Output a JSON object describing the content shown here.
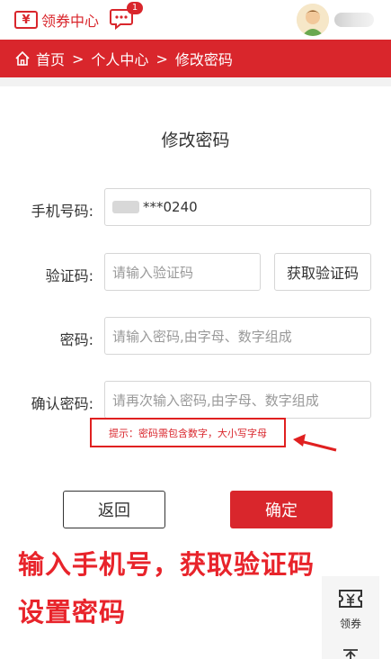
{
  "header": {
    "logo_mark": "¥",
    "app_name": "领券中心",
    "message_badge": "1"
  },
  "breadcrumb": {
    "items": [
      "首页",
      "个人中心",
      "修改密码"
    ],
    "separator": ">"
  },
  "form": {
    "title": "修改密码",
    "phone": {
      "label": "手机号码:",
      "value": "***0240"
    },
    "code": {
      "label": "验证码:",
      "placeholder": "请输入验证码",
      "button": "获取验证码"
    },
    "password": {
      "label": "密码:",
      "placeholder": "请输入密码,由字母、数字组成"
    },
    "confirm": {
      "label": "确认密码:",
      "placeholder": "请再次输入密码,由字母、数字组成"
    },
    "hint": "提示：密码需包含数字，大小写字母",
    "back_button": "返回",
    "confirm_button": "确定"
  },
  "annotation": {
    "line1": "输入手机号，获取验证码",
    "line2": "设置密码"
  },
  "float_widget": {
    "label": "领券",
    "icon": "coupon-icon"
  },
  "colors": {
    "brand_red": "#d9262c",
    "annotation_red": "#e8242b"
  }
}
